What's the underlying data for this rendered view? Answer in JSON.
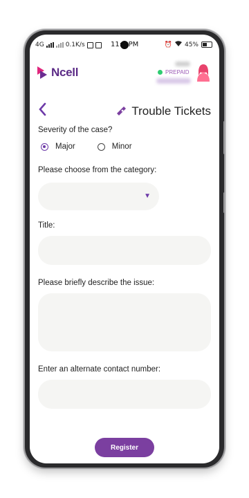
{
  "status_bar": {
    "network": "4G",
    "speed": "0.1K/s",
    "time": "11:2 PM",
    "battery": "45%"
  },
  "header": {
    "brand": "Ncell",
    "account_type": "PREPAID"
  },
  "page": {
    "title": "Trouble Tickets"
  },
  "form": {
    "severity_label": "Severity of the case?",
    "severity_options": [
      "Major",
      "Minor"
    ],
    "severity_selected": "Major",
    "category_label": "Please choose from the category:",
    "category_value": "",
    "title_label": "Title:",
    "title_value": "",
    "description_label": "Please briefly describe the issue:",
    "description_value": "",
    "contact_label": "Enter an alternate contact number:",
    "contact_value": "",
    "register_label": "Register"
  },
  "colors": {
    "accent": "#6d3aa8",
    "button": "#7b3fa0",
    "field_bg": "#f5f5f3"
  }
}
